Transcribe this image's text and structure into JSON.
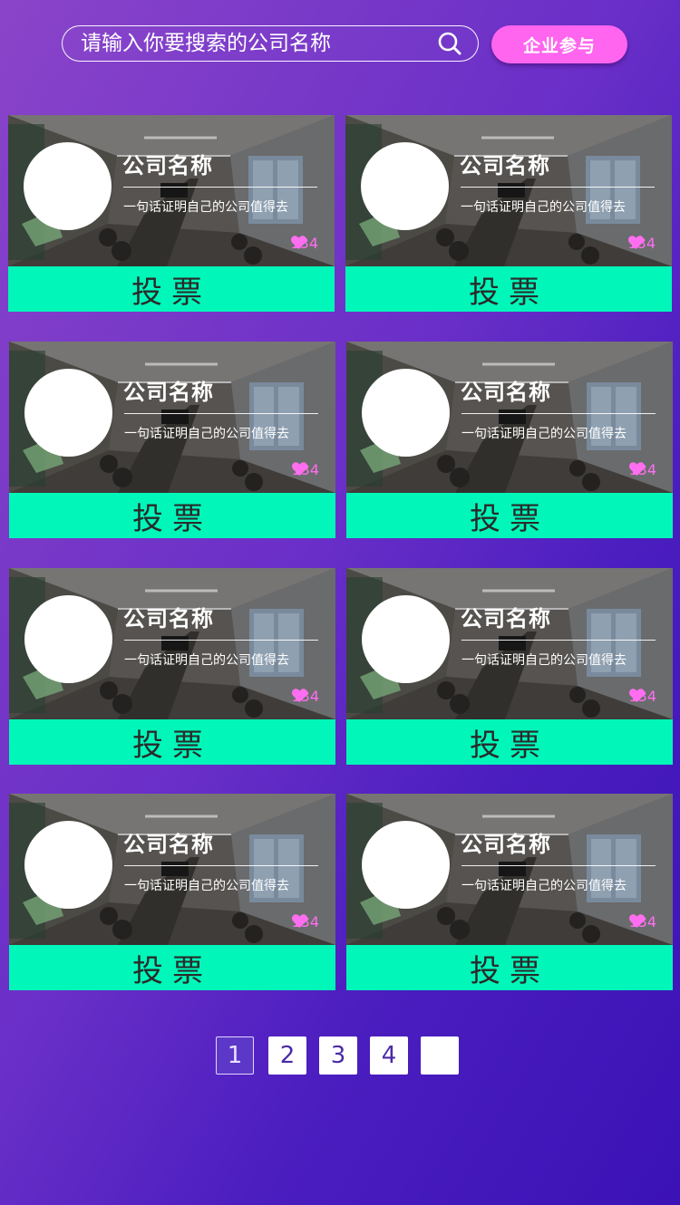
{
  "search": {
    "placeholder": "请输入你要搜索的公司名称"
  },
  "header": {
    "join_label": "企业参与"
  },
  "colors": {
    "accent_pink": "#ff65ee",
    "vote_green": "#00f7b9",
    "likes_pink": "#ff6ef0",
    "background_start": "#8a44c9",
    "background_end": "#3b12b6"
  },
  "cards": [
    {
      "name": "公司名称",
      "slogan": "一句话证明自己的公司值得去",
      "likes": "134",
      "vote_label": "投票"
    },
    {
      "name": "公司名称",
      "slogan": "一句话证明自己的公司值得去",
      "likes": "134",
      "vote_label": "投票"
    },
    {
      "name": "公司名称",
      "slogan": "一句话证明自己的公司值得去",
      "likes": "134",
      "vote_label": "投票"
    },
    {
      "name": "公司名称",
      "slogan": "一句话证明自己的公司值得去",
      "likes": "134",
      "vote_label": "投票"
    },
    {
      "name": "公司名称",
      "slogan": "一句话证明自己的公司值得去",
      "likes": "134",
      "vote_label": "投票"
    },
    {
      "name": "公司名称",
      "slogan": "一句话证明自己的公司值得去",
      "likes": "134",
      "vote_label": "投票"
    },
    {
      "name": "公司名称",
      "slogan": "一句话证明自己的公司值得去",
      "likes": "134",
      "vote_label": "投票"
    },
    {
      "name": "公司名称",
      "slogan": "一句话证明自己的公司值得去",
      "likes": "134",
      "vote_label": "投票"
    }
  ],
  "pagination": {
    "pages": [
      "1",
      "2",
      "3",
      "4"
    ],
    "current": "1",
    "next_label": ""
  }
}
